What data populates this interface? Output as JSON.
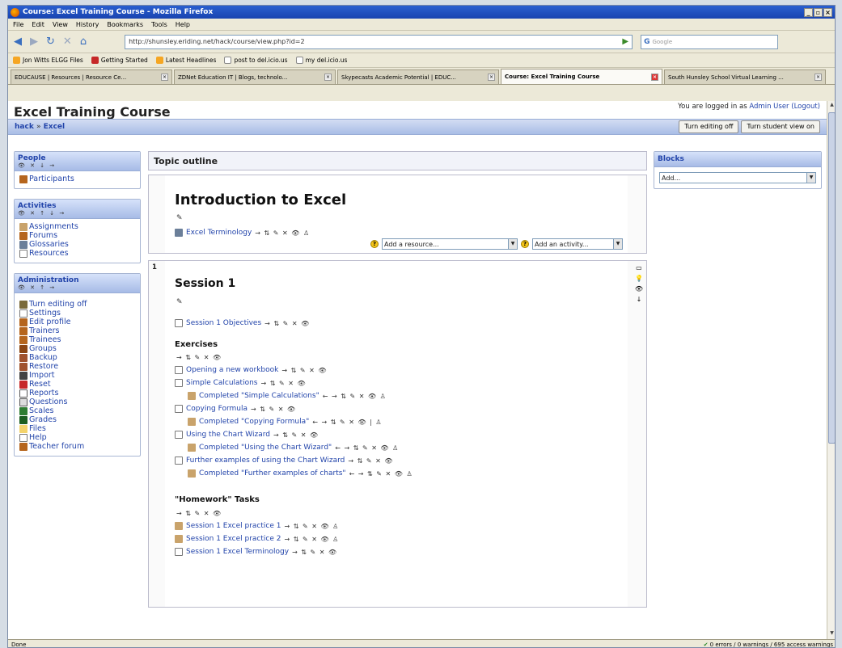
{
  "window": {
    "title": "Course: Excel Training Course - Mozilla Firefox"
  },
  "menu": [
    "File",
    "Edit",
    "View",
    "History",
    "Bookmarks",
    "Tools",
    "Help"
  ],
  "url": "http://shunsley.eriding.net/hack/course/view.php?id=2",
  "search_placeholder": "Google",
  "bookmarks": [
    "Jon Witts ELGG Files",
    "Getting Started",
    "Latest Headlines",
    "post to del.icio.us",
    "my del.icio.us"
  ],
  "tabs": [
    "EDUCAUSE | Resources | Resource Ce...",
    "ZDNet Education IT | Blogs, technolo...",
    "Skypecasts Academic Potential | EDUC...",
    "Course: Excel Training Course",
    "South Hunsley School Virtual Learning ..."
  ],
  "page": {
    "title": "Excel Training Course",
    "login_prefix": "You are logged in as",
    "login_user": "Admin User",
    "logout": "(Logout)",
    "crumb_home": "hack",
    "crumb_sep": "»",
    "crumb_current": "Excel",
    "btn_editing": "Turn editing off",
    "btn_student": "Turn student view on"
  },
  "people": {
    "title": "People",
    "controls": "👁 ✕ ↓ →",
    "items": [
      "Participants"
    ]
  },
  "activities": {
    "title": "Activities",
    "controls": "👁 ✕ ↑ ↓ →",
    "items": [
      "Assignments",
      "Forums",
      "Glossaries",
      "Resources"
    ]
  },
  "admin": {
    "title": "Administration",
    "controls": "👁 ✕ ↑ →",
    "items": [
      "Turn editing off",
      "Settings",
      "Edit profile",
      "Trainers",
      "Trainees",
      "Groups",
      "Backup",
      "Restore",
      "Import",
      "Reset",
      "Reports",
      "Questions",
      "Scales",
      "Grades",
      "Files",
      "Help",
      "Teacher forum"
    ]
  },
  "main": {
    "topic_outline": "Topic outline",
    "intro_heading": "Introduction to Excel",
    "intro_item": "Excel Terminology",
    "add_resource": "Add a resource...",
    "add_activity": "Add an activity...",
    "section_number": "1",
    "session_heading": "Session 1",
    "session_objectives": "Session 1 Objectives",
    "exercises_heading": "Exercises",
    "exercises": [
      "Opening a new workbook",
      "Simple Calculations",
      "Completed \"Simple Calculations\"",
      "Copying Formula",
      "Completed \"Copying Formula\"",
      "Using the Chart Wizard",
      "Completed \"Using the Chart Wizard\"",
      "Further examples of using the Chart Wizard",
      "Completed \"Further examples of charts\""
    ],
    "homework_heading": "\"Homework\" Tasks",
    "homework": [
      "Session 1 Excel practice 1",
      "Session 1 Excel practice 2",
      "Session 1 Excel Terminology"
    ]
  },
  "blocks_side": {
    "title": "Blocks",
    "select": "Add..."
  },
  "status": {
    "left": "Done",
    "right": "0 errors / 0 warnings / 695 access warnings"
  },
  "colors": {
    "link": "#2244aa",
    "block_header": "#a7bbe6",
    "title_bar": "#1843b0"
  }
}
